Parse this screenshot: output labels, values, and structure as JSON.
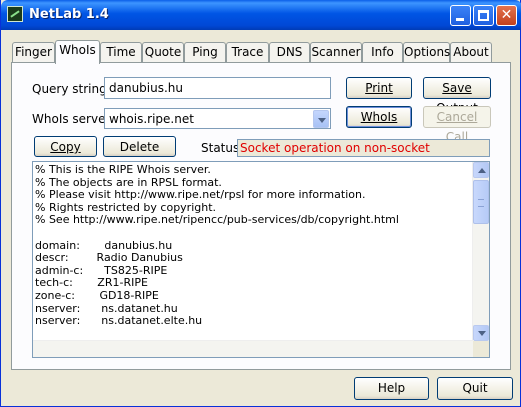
{
  "window": {
    "title": "NetLab 1.4"
  },
  "tabs": [
    "Finger",
    "WhoIs",
    "Time",
    "Quote",
    "Ping",
    "Trace",
    "DNS",
    "Scanner",
    "Info",
    "Options",
    "About"
  ],
  "active_tab": "WhoIs",
  "query": {
    "label": "Query string:",
    "value": "danubius.hu"
  },
  "server": {
    "label": "WhoIs server:",
    "value": "whois.ripe.net"
  },
  "buttons": {
    "print": "Print",
    "save_output": "Save Output",
    "whois": "WhoIs",
    "cancel_call": "Cancel Call",
    "copy": "Copy",
    "delete_server": "Delete Server",
    "help": "Help",
    "quit": "Quit"
  },
  "status": {
    "label": "Status:",
    "text": "Socket operation on non-socket",
    "color": "#e00000"
  },
  "output_lines": [
    "% This is the RIPE Whois server.",
    "% The objects are in RPSL format.",
    "% Please visit http://www.ripe.net/rpsl for more information.",
    "% Rights restricted by copyright.",
    "% See http://www.ripe.net/ripencc/pub-services/db/copyright.html",
    "",
    "domain:       danubius.hu",
    "descr:        Radio Danubius",
    "admin-c:      TS825-RIPE",
    "tech-c:       ZR1-RIPE",
    "zone-c:       GD18-RIPE",
    "nserver:      ns.datanet.hu",
    "nserver:      ns.datanet.elte.hu"
  ]
}
